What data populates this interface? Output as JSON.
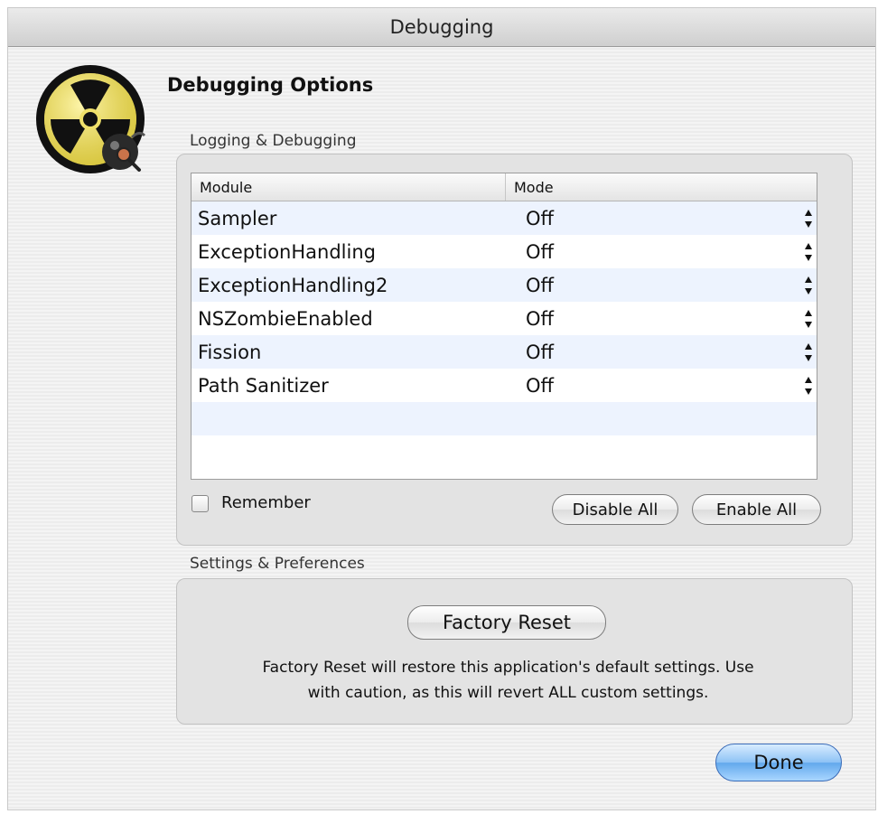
{
  "window": {
    "title": "Debugging"
  },
  "heading": "Debugging Options",
  "logging_group": {
    "label": "Logging & Debugging",
    "columns": [
      "Module",
      "Mode"
    ],
    "rows": [
      {
        "module": "Sampler",
        "mode": "Off"
      },
      {
        "module": "ExceptionHandling",
        "mode": "Off"
      },
      {
        "module": "ExceptionHandling2",
        "mode": "Off"
      },
      {
        "module": "NSZombieEnabled",
        "mode": "Off"
      },
      {
        "module": "Fission",
        "mode": "Off"
      },
      {
        "module": "Path Sanitizer",
        "mode": "Off"
      }
    ],
    "remember_label": "Remember",
    "remember_checked": false,
    "disable_all_label": "Disable All",
    "enable_all_label": "Enable All"
  },
  "settings_group": {
    "label": "Settings & Preferences",
    "factory_reset_label": "Factory Reset",
    "note_line1": "Factory Reset will restore this application's default settings. Use",
    "note_line2": "with caution, as this will revert ALL custom settings."
  },
  "done_label": "Done",
  "icons": {
    "app": "radiation-bomb-icon",
    "stepper": "stepper-arrows-icon"
  },
  "colors": {
    "accent": "#62a8ec",
    "row_stripe": "#edf3fe"
  }
}
